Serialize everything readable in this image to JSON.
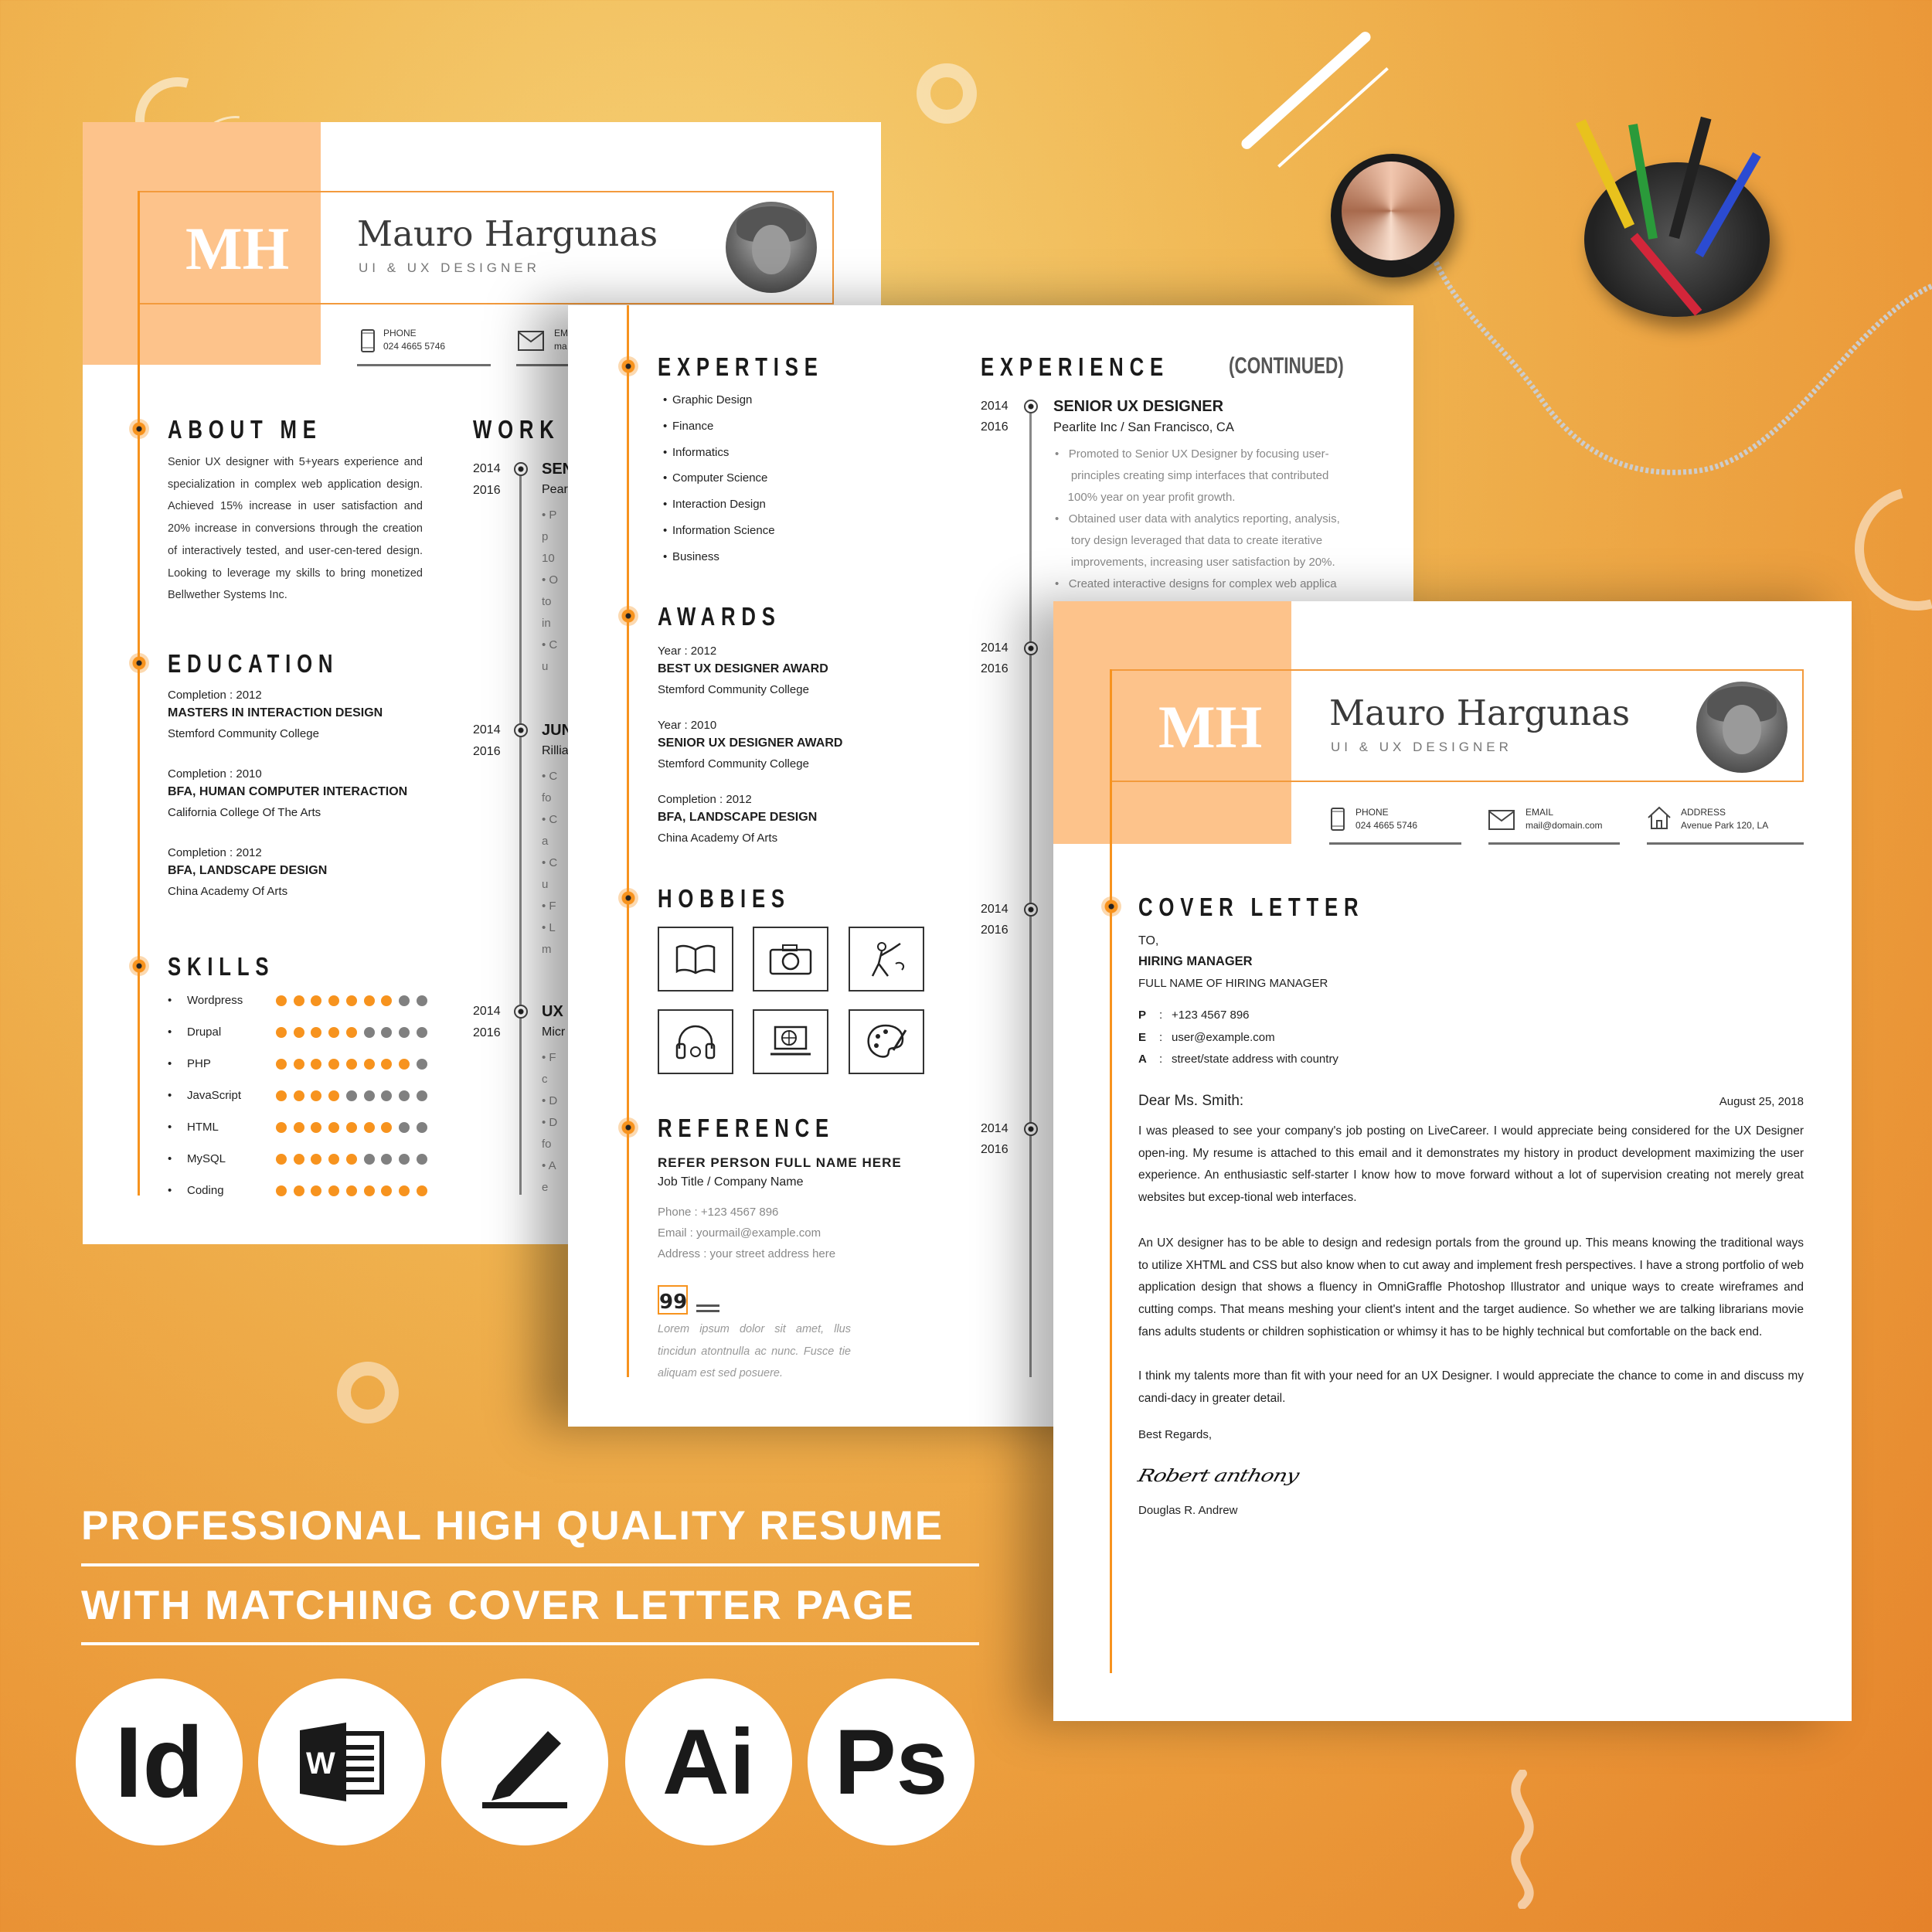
{
  "resume_page1": {
    "monogram": "MH",
    "name": "Mauro Hargunas",
    "title": "UI & UX DESIGNER",
    "contacts": [
      {
        "icon": "phone-icon",
        "label": "PHONE",
        "value": "024 4665 5746"
      },
      {
        "icon": "mail-icon",
        "label": "EM",
        "value": "ma"
      }
    ],
    "about": {
      "heading": "ABOUT ME",
      "text": "Senior UX designer with 5+years experience and specialization in complex web application design. Achieved 15% increase in user satisfaction and 20% increase in conversions through the creation of interactively tested, and user-cen-tered design. Looking to leverage my skills to bring monetized Bellwether Systems Inc."
    },
    "education": {
      "heading": "EDUCATION",
      "items": [
        {
          "completion": "Completion : 2012",
          "degree": "MASTERS IN INTERACTION DESIGN",
          "school": "Stemford Community College"
        },
        {
          "completion": "Completion : 2010",
          "degree": "BFA, HUMAN COMPUTER INTERACTION",
          "school": "California College Of The Arts"
        },
        {
          "completion": "Completion : 2012",
          "degree": "BFA, LANDSCAPE DESIGN",
          "school": "China Academy Of Arts"
        }
      ]
    },
    "skills": {
      "heading": "SKILLS",
      "max": 9,
      "items": [
        {
          "name": "Wordpress",
          "level": 7
        },
        {
          "name": "Drupal",
          "level": 5
        },
        {
          "name": "PHP",
          "level": 8
        },
        {
          "name": "JavaScript",
          "level": 4
        },
        {
          "name": "HTML",
          "level": 7
        },
        {
          "name": "MySQL",
          "level": 5
        },
        {
          "name": "Coding",
          "level": 9
        }
      ]
    },
    "work": {
      "heading": "WORK E",
      "items": [
        {
          "from": "2014",
          "to": "2016",
          "title": "SEN",
          "company": "Pear",
          "lines": [
            "• P",
            "p",
            "10",
            "• O",
            "to",
            "in",
            "• C",
            "u"
          ]
        },
        {
          "from": "2014",
          "to": "2016",
          "title": "JUN",
          "company": "Rillia",
          "lines": [
            "• C",
            "fo",
            "• C",
            "a",
            "• C",
            "u",
            "• F",
            "• L",
            "m"
          ]
        },
        {
          "from": "2014",
          "to": "2016",
          "title": "UX",
          "company": "Micr",
          "lines": [
            "• F",
            "c",
            "• D",
            "• D",
            "fo",
            "• A",
            "e"
          ]
        }
      ]
    }
  },
  "resume_page2": {
    "expertise": {
      "heading": "EXPERTISE",
      "items": [
        "Graphic Design",
        "Finance",
        "Informatics",
        "Computer Science",
        "Interaction Design",
        "Information Science",
        "Business"
      ]
    },
    "awards": {
      "heading": "AWARDS",
      "items": [
        {
          "year": "Year : 2012",
          "name": "BEST UX DESIGNER AWARD",
          "school": "Stemford Community College"
        },
        {
          "year": "Year : 2010",
          "name": "SENIOR UX DESIGNER AWARD",
          "school": "Stemford Community College"
        },
        {
          "year": "Completion : 2012",
          "name": "BFA, LANDSCAPE DESIGN",
          "school": "China Academy Of Arts"
        }
      ]
    },
    "hobbies": {
      "heading": "HOBBIES",
      "icons": [
        "book-icon",
        "camera-icon",
        "painter-icon",
        "headphones-icon",
        "laptop-globe-icon",
        "palette-icon"
      ]
    },
    "reference": {
      "heading": "REFERENCE",
      "name": "REFER PERSON FULL NAME HERE",
      "job": "Job Title / Company Name",
      "phone": "Phone  :  +123 4567 896",
      "email": "Email  :  yourmail@example.com",
      "address": "Address : your street address here",
      "quote": "Lorem ipsum dolor sit amet, llus tincidun atontnulla ac nunc. Fusce tie aliquam est sed posuere."
    },
    "experience": {
      "heading": "EXPERIENCE",
      "continued": "(CONTINUED)",
      "item": {
        "from": "2014",
        "to": "2016",
        "title": "SENIOR UX DESIGNER",
        "company": "Pearlite Inc / San Francisco, CA",
        "lines": [
          "•   Promoted to Senior UX Designer by focusing user-",
          "     principles creating simp interfaces that contributed",
          "    100% year on year profit growth.",
          "•   Obtained user data with analytics reporting, analysis,",
          "     tory design leveraged that data to create iterative",
          "     improvements, increasing user satisfaction by 20%.",
          "•   Created interactive designs for complex web applica"
        ]
      },
      "more_dates": [
        {
          "from": "2014",
          "to": "2016"
        },
        {
          "from": "2014",
          "to": "2016"
        },
        {
          "from": "2014",
          "to": "2016"
        }
      ]
    }
  },
  "cover_letter": {
    "monogram": "MH",
    "name": "Mauro Hargunas",
    "title": "UI & UX DESIGNER",
    "contacts": [
      {
        "icon": "phone-icon",
        "label": "PHONE",
        "value": "024 4665 5746"
      },
      {
        "icon": "mail-icon",
        "label": "EMAIL",
        "value": "mail@domain.com"
      },
      {
        "icon": "home-icon",
        "label": "ADDRESS",
        "value": "Avenue Park 120, LA"
      }
    ],
    "heading": "COVER LETTER",
    "to": "TO,",
    "recipient": "HIRING MANAGER",
    "recipient_name": "FULL NAME OF HIRING MANAGER",
    "details": [
      {
        "key": "P",
        "value": "+123 4567 896"
      },
      {
        "key": "E",
        "value": "user@example.com"
      },
      {
        "key": "A",
        "value": "street/state address with country"
      }
    ],
    "salutation": "Dear Ms. Smith:",
    "date": "August 25, 2018",
    "paragraphs": [
      "I was pleased to see your company's job posting on LiveCareer. I would appreciate being considered for the UX Designer open-ing. My resume is attached to this email and it demonstrates my history in product development maximizing the user experience. An enthusiastic self-starter I know how to move forward without a lot of supervision creating not merely great websites but excep-tional web interfaces.",
      "An UX designer has to be able to design and redesign portals from the ground up. This means knowing the traditional ways to utilize XHTML and CSS but also know when to cut away and implement fresh perspectives. I have a strong portfolio of web application design that shows a fluency in OmniGraffle Photoshop Illustrator and unique ways to create wireframes and cutting comps. That means meshing your client's intent and the target audience. So whether we are talking librarians movie fans adults students or children sophistication or whimsy it has to be highly technical but comfortable on the back end.",
      "I think my talents more than fit with your need for an UX Designer. I would appreciate the chance to come in and discuss my candi-dacy in greater detail."
    ],
    "closing": "Best Regards,",
    "signature": "Robert anthony",
    "signer": "Douglas R. Andrew"
  },
  "promo": {
    "line1": "PROFESSIONAL HIGH QUALITY  RESUME",
    "line2": "WITH MATCHING COVER LETTER PAGE",
    "apps": [
      {
        "icon": "indesign-icon",
        "label": "Id"
      },
      {
        "icon": "word-icon",
        "label": "W"
      },
      {
        "icon": "pen-icon",
        "label": ""
      },
      {
        "icon": "illustrator-icon",
        "label": "Ai"
      },
      {
        "icon": "photoshop-icon",
        "label": "Ps"
      }
    ]
  },
  "colors": {
    "accent": "#f7931e",
    "peach": "#fdc38b",
    "skill_off": "#808080"
  }
}
